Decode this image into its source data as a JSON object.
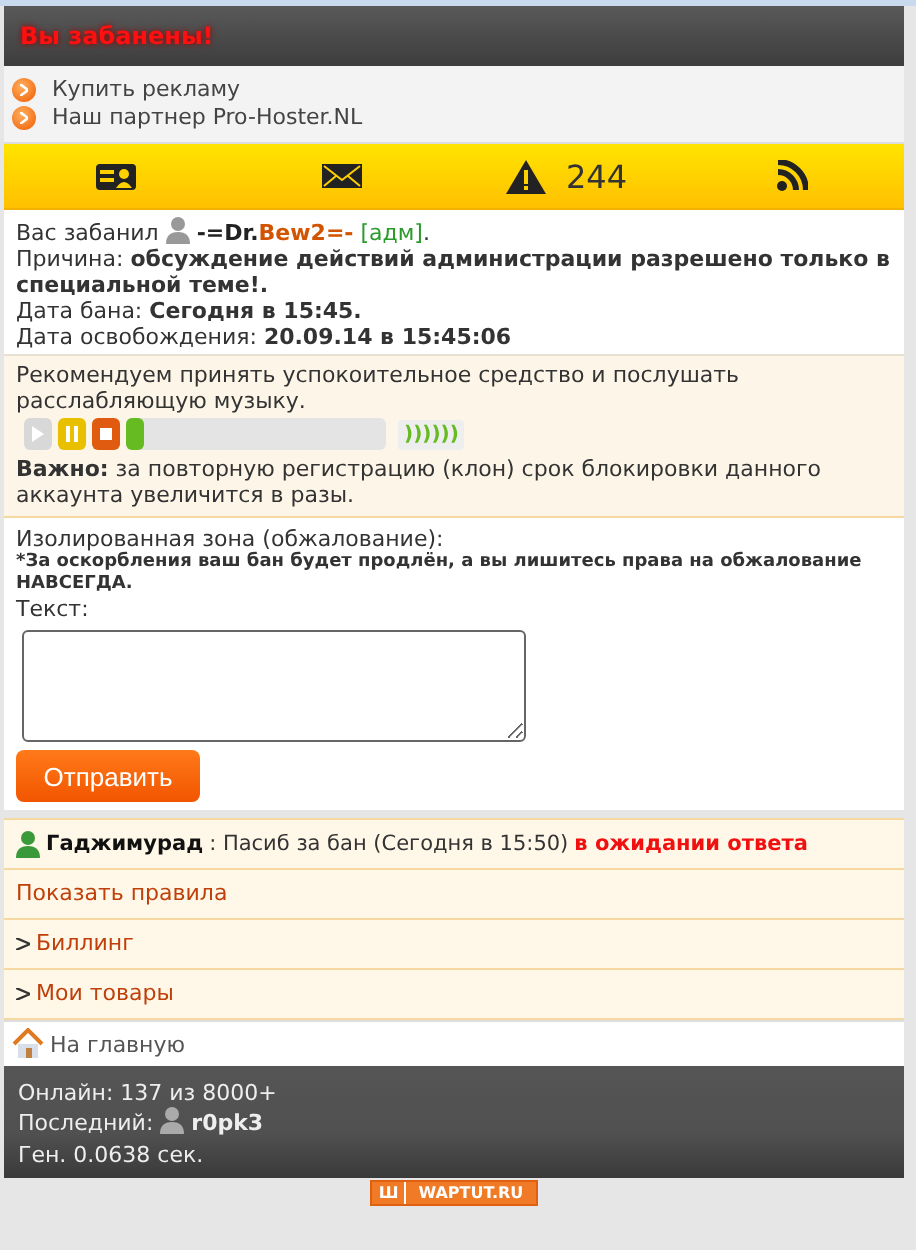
{
  "header": {
    "title": "Вы забанены!"
  },
  "ad_links": [
    "Купить рекламу",
    "Наш партнер Pro-Hoster.NL"
  ],
  "toolbar": [
    {
      "kind": "card"
    },
    {
      "kind": "mail"
    },
    {
      "kind": "alert",
      "count": "244"
    },
    {
      "kind": "rss"
    }
  ],
  "ban": {
    "prefix": "Вас забанил",
    "admin_nick_dark": "-=Dr.",
    "admin_nick_accent": "Bew2",
    "admin_nick_tail": "=-",
    "role": "[адм]",
    "role_end": ".",
    "reason_label": "Причина:",
    "reason": "обсуждение действий администрации разрешено только в специальной теме!.",
    "date_label": "Дата бана:",
    "date": "Сегодня в 15:45.",
    "release_label": "Дата освобождения:",
    "release": "20.09.14 в 15:45:06"
  },
  "music": {
    "text": "Рекомендуем принять успокоительное средство и послушать расслабляющую музыку.",
    "player": {
      "level": 0.04,
      "volume": "))))))"
    },
    "warning": "**Важно:** за повторную регистрацию (клон) срок блокировки данного аккаунта увеличится в разы."
  },
  "appeal": {
    "title": "Изолированная зона (обжалование):",
    "notice": "*За оскорбления ваш бан будет продлён, а вы лишитесь права на обжалование НАВСЕГДА.",
    "field_label": "Текст:",
    "submit": "Отправить"
  },
  "message": {
    "author": "Гаджимурад",
    "text": ": Пасиб за бан (Сегодня в 15:50)",
    "status": "в ожидании ответа"
  },
  "menu": [
    {
      "label": "Показать правила",
      "arrow": false
    },
    {
      "label": "Биллинг",
      "arrow": true
    },
    {
      "label": "Мои товары",
      "arrow": true
    }
  ],
  "home": "На главную",
  "footer": {
    "online": "Онлайн: 137 из 8000+",
    "last_label": "Последний:",
    "last_user": "r0pk3",
    "gen": "Ген. 0.0638 сек."
  },
  "badge": {
    "logo": "Ш",
    "text": "WAPTUT.RU"
  }
}
